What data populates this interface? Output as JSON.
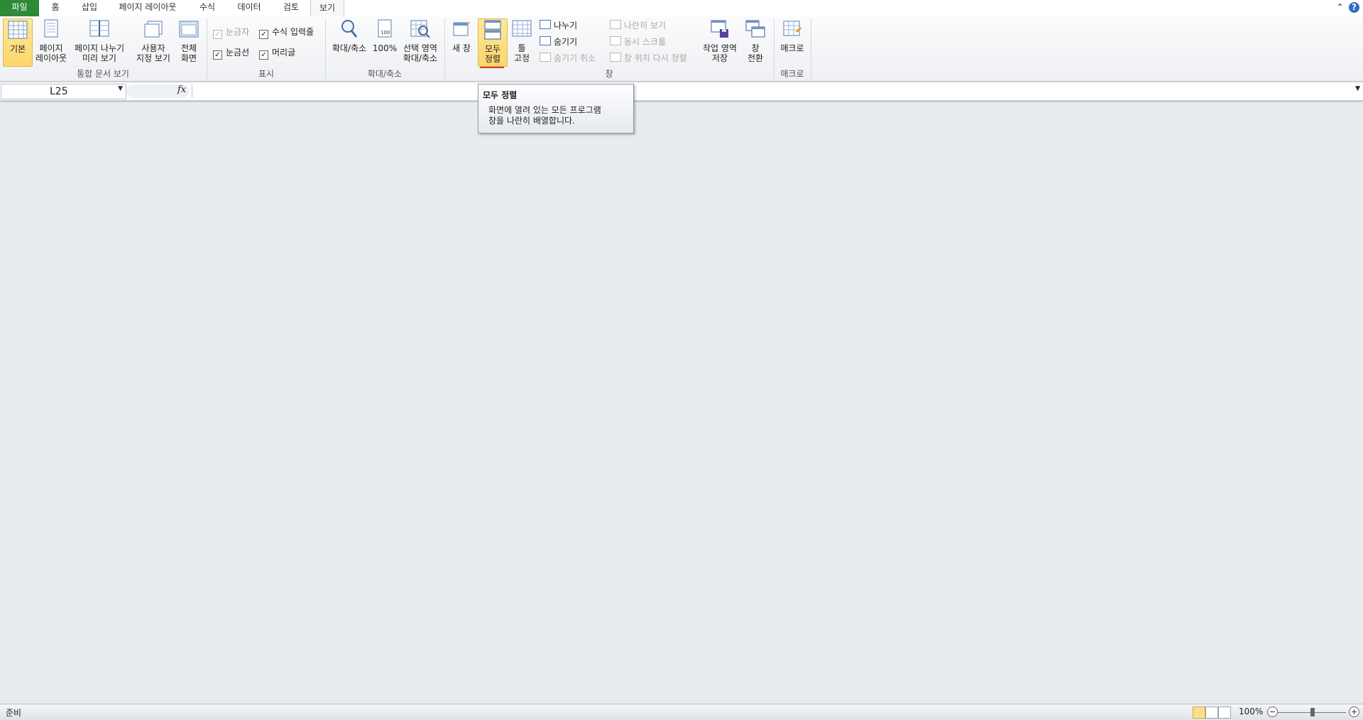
{
  "tabs": {
    "file": "파일",
    "home": "홈",
    "insert": "삽입",
    "page_layout": "페이지 레이아웃",
    "formulas": "수식",
    "data": "데이터",
    "review": "검토",
    "view": "보기"
  },
  "ribbon": {
    "workbook_views": {
      "label": "통합 문서 보기",
      "normal": "기본",
      "page_layout": "페이지\n레이아웃",
      "page_break_preview": "페이지 나누기\n미리 보기",
      "custom_views": "사용자\n지정 보기",
      "full_screen": "전체\n화면"
    },
    "show": {
      "label": "표시",
      "ruler": "눈금자",
      "formula_bar": "수식 입력줄",
      "gridlines": "눈금선",
      "headings": "머리글",
      "ruler_checked": true,
      "formula_bar_checked": true,
      "gridlines_checked": true,
      "headings_checked": true
    },
    "zoom": {
      "label": "확대/축소",
      "zoom": "확대/축소",
      "hundred": "100%",
      "zoom_selection": "선택 영역\n확대/축소"
    },
    "window": {
      "label": "창",
      "new_window": "새 창",
      "arrange_all": "모두\n정렬",
      "freeze_panes": "틀\n고정",
      "split": "나누기",
      "hide": "숨기기",
      "unhide": "숨기기 취소",
      "side_by_side": "나란히 보기",
      "sync_scroll": "동시 스크롤",
      "reset_position": "창 위치 다시 정렬",
      "save_workspace": "작업 영역\n저장",
      "switch_windows": "창\n전환"
    },
    "macros": {
      "label": "매크로",
      "macros": "매크로"
    }
  },
  "formula_bar": {
    "name_box": "L25",
    "fx": "fx",
    "value": ""
  },
  "tooltip": {
    "title": "모두 정렬",
    "body_line1": "화면에 열려 있는 모든 프로그램",
    "body_line2": "창을 나란히 배열합니다."
  },
  "status_bar": {
    "status": "준비",
    "zoom": "100%",
    "zoom_out": "−",
    "zoom_in": "+"
  },
  "colors": {
    "file_tab": "#2d8a36",
    "selected_button": "#fcd66a",
    "workspace": "#e8ebf0"
  }
}
